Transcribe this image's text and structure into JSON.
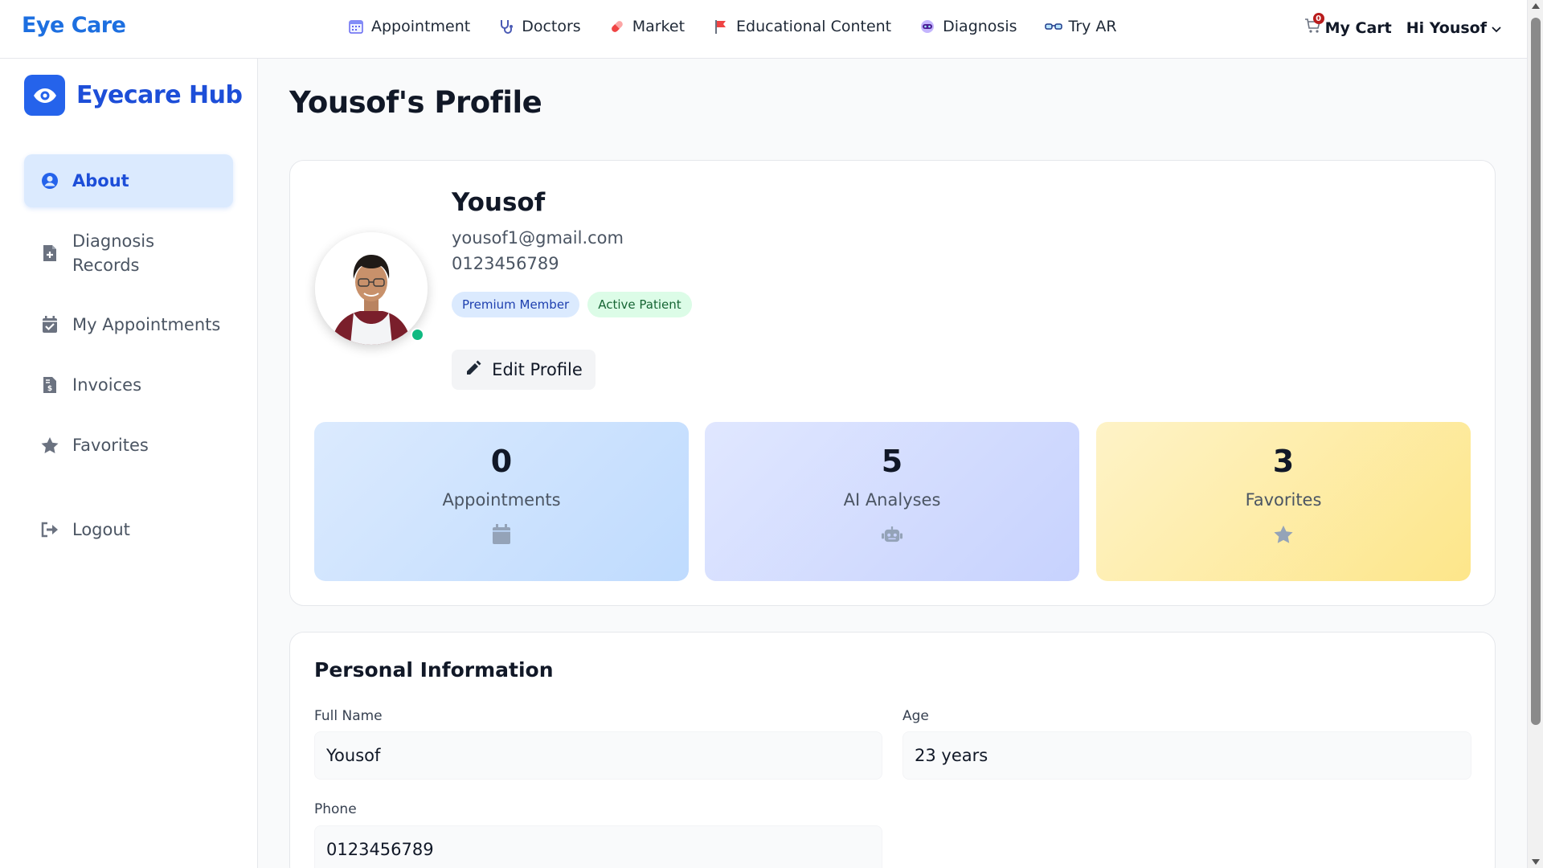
{
  "brand": "Eye Care",
  "nav": {
    "links": [
      {
        "label": "Appointment",
        "icon": "calendar-icon"
      },
      {
        "label": "Doctors",
        "icon": "stethoscope-icon"
      },
      {
        "label": "Market",
        "icon": "pill-icon"
      },
      {
        "label": "Educational Content",
        "icon": "flag-icon"
      },
      {
        "label": "Diagnosis",
        "icon": "robot-icon"
      },
      {
        "label": "Try AR",
        "icon": "glasses-icon"
      }
    ],
    "cart_label": "My Cart",
    "cart_count": "0",
    "user_greeting": "Hi Yousof"
  },
  "sidebar": {
    "title": "Eyecare Hub",
    "items": [
      {
        "label": "About",
        "icon": "user-circle-icon",
        "active": true
      },
      {
        "label": "Diagnosis Records",
        "icon": "file-medical-icon"
      },
      {
        "label": "My Appointments",
        "icon": "calendar-check-icon"
      },
      {
        "label": "Invoices",
        "icon": "invoice-icon"
      },
      {
        "label": "Favorites",
        "icon": "star-icon"
      },
      {
        "label": "Logout",
        "icon": "logout-icon"
      }
    ]
  },
  "page_title": "Yousof's Profile",
  "profile": {
    "name": "Yousof",
    "email": "yousof1@gmail.com",
    "phone": "0123456789",
    "badges": [
      "Premium Member",
      "Active Patient"
    ],
    "edit_label": "Edit Profile",
    "stats": [
      {
        "value": "0",
        "label": "Appointments",
        "icon": "calendar-icon"
      },
      {
        "value": "5",
        "label": "AI Analyses",
        "icon": "robot-icon"
      },
      {
        "value": "3",
        "label": "Favorites",
        "icon": "star-icon"
      }
    ]
  },
  "personal_info": {
    "title": "Personal Information",
    "fields": [
      {
        "label": "Full Name",
        "value": "Yousof"
      },
      {
        "label": "Age",
        "value": "23 years"
      },
      {
        "label": "Phone",
        "value": "0123456789"
      }
    ]
  },
  "colors": {
    "brand": "#1d6fe0",
    "accent": "#2563eb",
    "online": "#10b981"
  }
}
